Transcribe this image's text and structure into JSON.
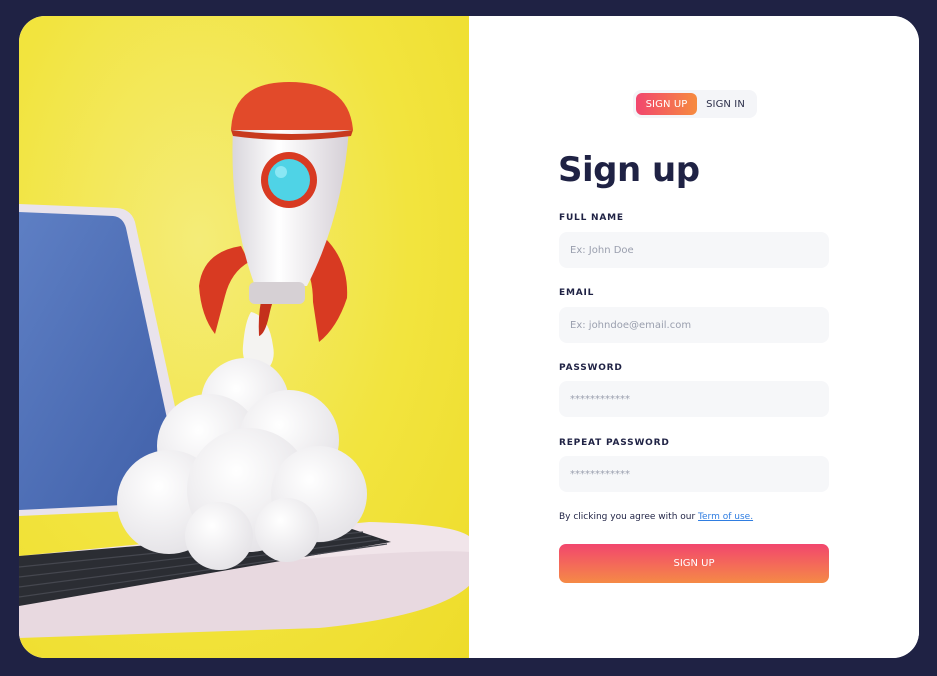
{
  "toggle": {
    "signup_label": "SIGN UP",
    "signin_label": "SIGN IN"
  },
  "form": {
    "title": "Sign up",
    "fields": [
      {
        "label": "FULL NAME",
        "placeholder": "Ex: John Doe"
      },
      {
        "label": "EMAIL",
        "placeholder": "Ex: johndoe@email.com"
      },
      {
        "label": "PASSWORD",
        "placeholder": "************"
      },
      {
        "label": "REPEAT PASSWORD",
        "placeholder": "************"
      }
    ],
    "terms_text": "By clicking you agree with our ",
    "terms_link": "Term of use.",
    "submit_label": "SIGN UP"
  },
  "colors": {
    "page_background": "#1f2244",
    "accent_start": "#f2466e",
    "accent_end": "#f68b3f",
    "hero_background": "#f2e43e"
  }
}
